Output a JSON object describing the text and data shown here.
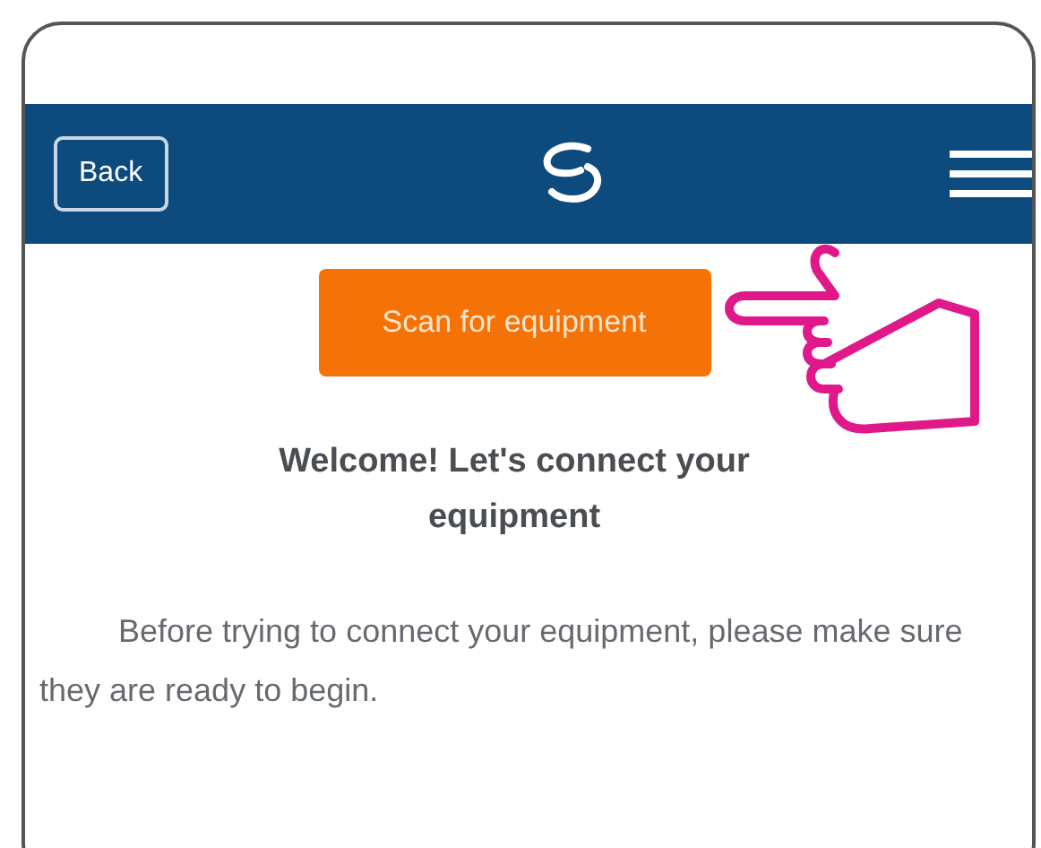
{
  "header": {
    "back_button": "Back"
  },
  "scan_button": "Scan for equipment",
  "heading": "Welcome! Let's connect your equipment",
  "paragraph": "Before trying to connect your equipment, please make sure they are ready to begin."
}
